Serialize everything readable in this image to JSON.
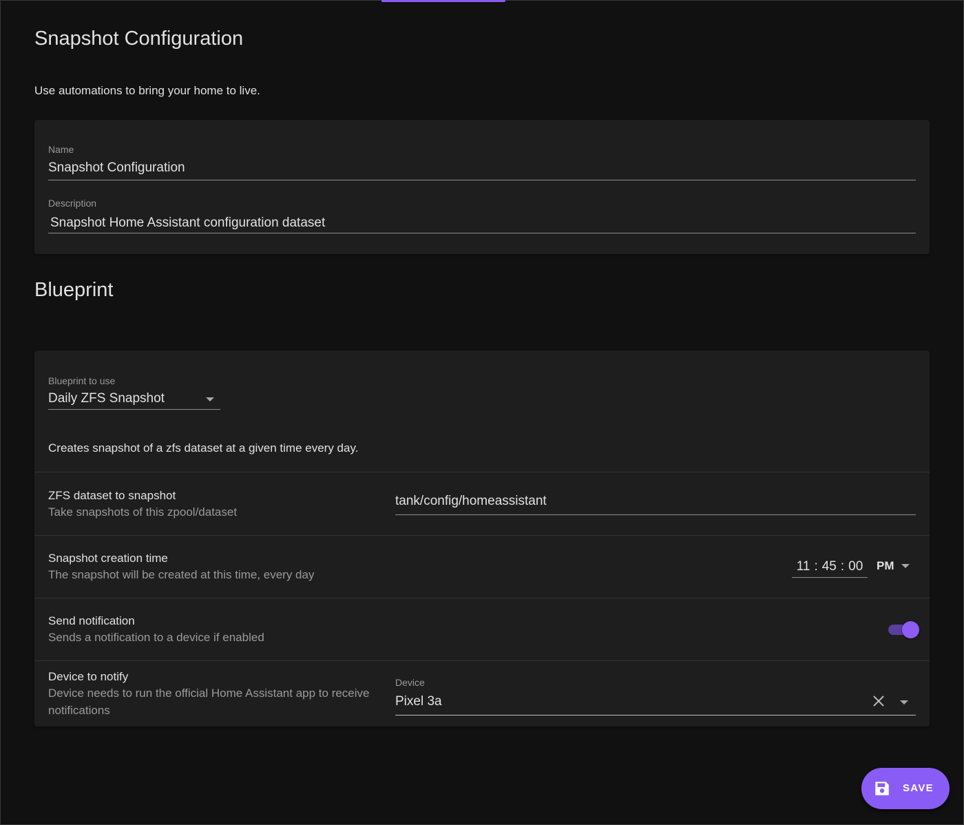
{
  "header": {
    "title": "Snapshot Configuration",
    "intro": "Use automations to bring your home to live."
  },
  "details": {
    "name_label": "Name",
    "name_value": "Snapshot Configuration",
    "description_label": "Description",
    "description_value": "Snapshot Home Assistant configuration dataset"
  },
  "blueprint": {
    "section_title": "Blueprint",
    "select_label": "Blueprint to use",
    "select_value": "Daily ZFS Snapshot",
    "description": "Creates snapshot of a zfs dataset at a given time every day.",
    "inputs": [
      {
        "title": "ZFS dataset to snapshot",
        "description": "Take snapshots of this zpool/dataset",
        "value": "tank/config/homeassistant"
      },
      {
        "title": "Snapshot creation time",
        "description": "The snapshot will be created at this time, every day",
        "time": {
          "hours": "11",
          "minutes": "45",
          "seconds": "00",
          "sep": ":",
          "period": "PM"
        }
      },
      {
        "title": "Send notification",
        "description": "Sends a notification to a device if enabled",
        "enabled": true
      },
      {
        "title": "Device to notify",
        "description": "Device needs to run the official Home Assistant app to receive notifications",
        "field_label": "Device",
        "value": "Pixel 3a"
      }
    ]
  },
  "actions": {
    "save_label": "SAVE"
  },
  "icons": {
    "select_arrow": "chevron-down-icon",
    "clear": "close-icon",
    "save": "floppy-disk-icon"
  },
  "colors": {
    "accent": "#8a5cf6",
    "background": "#111111",
    "card": "#1e1e1e"
  }
}
